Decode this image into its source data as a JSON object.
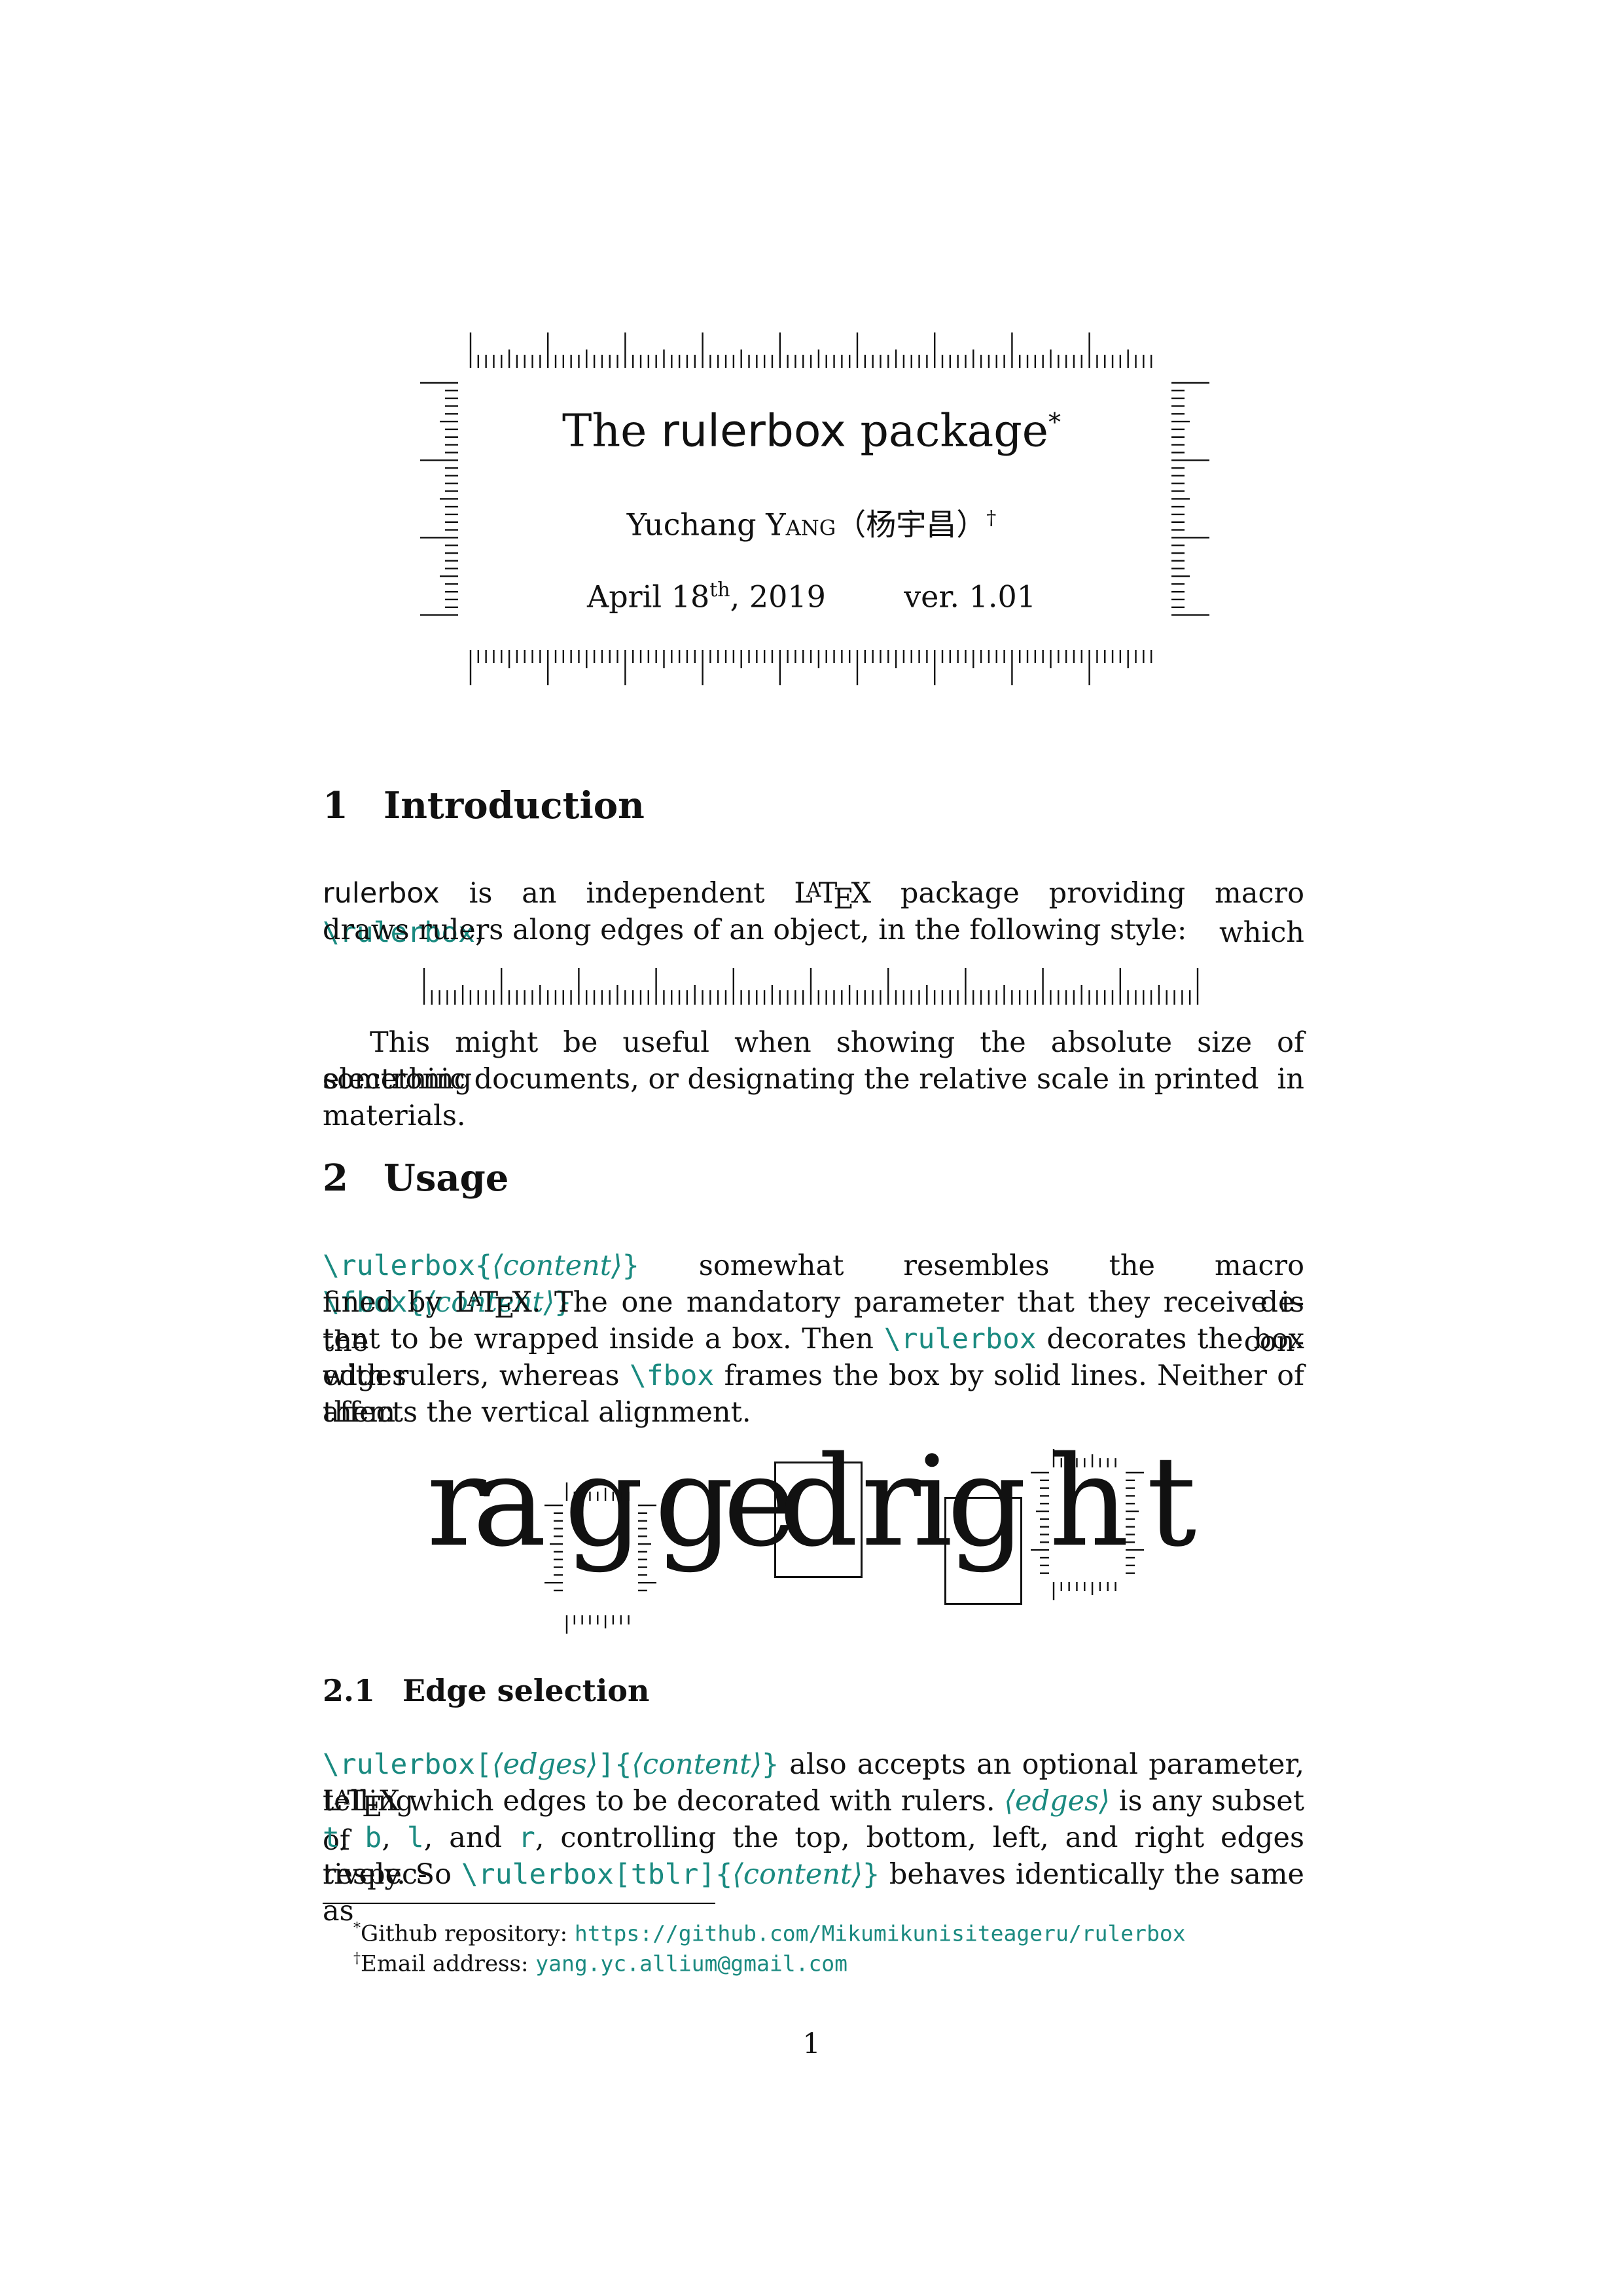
{
  "title": {
    "prefix": "The",
    "package_name": "rulerbox",
    "suffix": "package",
    "footnote_mark": "*"
  },
  "author": {
    "given": "Yuchang",
    "family": "Yang",
    "chinese": "（杨宇昌）",
    "footnote_mark": "†"
  },
  "date": {
    "month_day": "April 18",
    "ordinal": "th",
    "year": ", 2019",
    "version": "ver. 1.01"
  },
  "sections": [
    {
      "number": "1",
      "title": "Introduction"
    },
    {
      "number": "2",
      "title": "Usage"
    }
  ],
  "subsections": [
    {
      "number": "2.1",
      "title": "Edge selection"
    }
  ],
  "intro": {
    "pkg": "rulerbox",
    "t1": " is an independent ",
    "latex": "LaTeX",
    "t2": " package providing macro ",
    "macro": "\\rulerbox",
    "t3": ", which",
    "line2": "draws rulers along edges of an object, in the following style:",
    "p2_line1": "This might be useful when showing the absolute size of something in",
    "p2_line2": "electronic documents, or designating the relative scale in printed materials."
  },
  "usage": {
    "l1_macro1": "\\rulerbox{",
    "l1_arg1": "⟨content⟩",
    "l1_close1": "}",
    "l1_text": " somewhat resembles the macro ",
    "l1_macro2": "\\fbox{",
    "l1_arg2": "⟨content⟩",
    "l1_close2": "}",
    "l1_end": " de-",
    "l2_a": "fined by ",
    "l2_latex": "LaTeX",
    "l2_b": ". The one mandatory parameter that they receive is the con-",
    "l3_a": "tent to be wrapped inside a box. Then ",
    "l3_macro": "\\rulerbox",
    "l3_b": " decorates the box edges",
    "l4_a": "with rulers, whereas ",
    "l4_macro": "\\fbox",
    "l4_b": " frames the box by solid lines. Neither of them",
    "l5": "affects the vertical alignment."
  },
  "demo": {
    "letters": [
      "r",
      "a",
      "g",
      "g",
      "e",
      "d",
      "r",
      "i",
      "g",
      "h",
      "t"
    ]
  },
  "edge": {
    "l1_macro": "\\rulerbox[",
    "l1_arg1": "⟨edges⟩",
    "l1_mid": "]{",
    "l1_arg2": "⟨content⟩",
    "l1_close": "}",
    "l1_text": " also accepts an optional parameter, telling",
    "l2_latex": "LaTeX",
    "l2_a": " which edges to be decorated with rulers. ",
    "l2_arg": "⟨edges⟩",
    "l2_b": " is any subset of",
    "l3_t": "t",
    "l3_c1": ", ",
    "l3_b": "b",
    "l3_c2": ", ",
    "l3_l": "l",
    "l3_and": ", and ",
    "l3_r": "r",
    "l3_rest": ", controlling the top, bottom, left, and right edges respec-",
    "l4_a": "tively. So ",
    "l4_macro": "\\rulerbox[tblr]{",
    "l4_arg": "⟨content⟩",
    "l4_close": "}",
    "l4_b": " behaves identically the same as"
  },
  "footnotes": [
    {
      "mark": "*",
      "label": "Github repository: ",
      "value": "https://github.com/Mikumikunisiteageru/rulerbox"
    },
    {
      "mark": "†",
      "label": "Email address: ",
      "value": "yang.yc.allium@gmail.com"
    }
  ],
  "page_number": "1"
}
